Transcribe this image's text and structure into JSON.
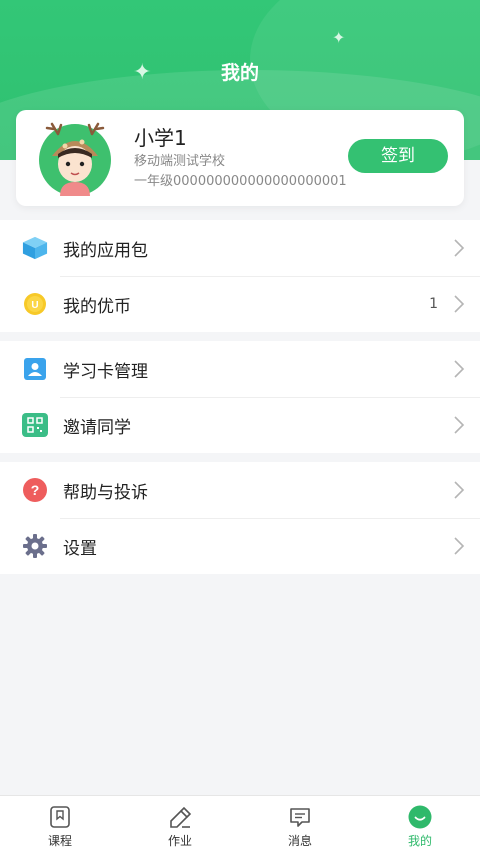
{
  "header": {
    "title": "我的"
  },
  "profile": {
    "name": "小学1",
    "school": "移动端测试学校",
    "grade_id": "一年级000000000000000000001",
    "signin_label": "签到"
  },
  "menu": {
    "group1": [
      {
        "label": "我的应用包",
        "icon": "cube-icon"
      },
      {
        "label": "我的优币",
        "icon": "coin-icon",
        "count": "1"
      }
    ],
    "group2": [
      {
        "label": "学习卡管理",
        "icon": "contact-card-icon"
      },
      {
        "label": "邀请同学",
        "icon": "qrcode-icon"
      }
    ],
    "group3": [
      {
        "label": "帮助与投诉",
        "icon": "help-icon"
      },
      {
        "label": "设置",
        "icon": "gear-icon"
      }
    ]
  },
  "tabbar": {
    "tabs": [
      {
        "label": "课程",
        "icon": "bookmark-book-icon"
      },
      {
        "label": "作业",
        "icon": "eraser-pencil-icon"
      },
      {
        "label": "消息",
        "icon": "message-icon"
      },
      {
        "label": "我的",
        "icon": "smile-icon",
        "active": true
      }
    ]
  },
  "colors": {
    "brand": "#34c172",
    "header": "#33c777"
  }
}
